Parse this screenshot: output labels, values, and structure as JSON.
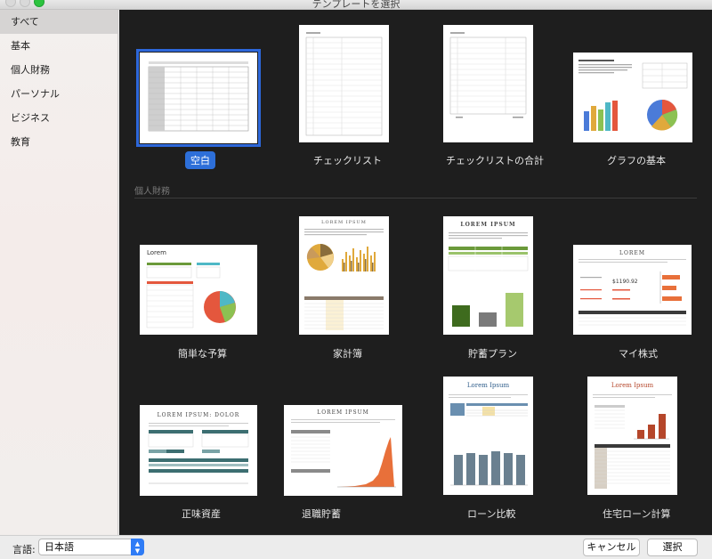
{
  "window": {
    "title": "テンプレートを選択"
  },
  "sidebar": {
    "items": [
      {
        "label": "すべて",
        "selected": true
      },
      {
        "label": "基本"
      },
      {
        "label": "個人財務"
      },
      {
        "label": "パーソナル"
      },
      {
        "label": "ビジネス"
      },
      {
        "label": "教育"
      }
    ]
  },
  "section": {
    "personal_finance": "個人財務"
  },
  "templates": {
    "blank": "空白",
    "checklist": "チェックリスト",
    "checklist_total": "チェックリストの合計",
    "chart_basics": "グラフの基本",
    "simple_budget": "簡単な予算",
    "household_budget": "家計簿",
    "savings_plan": "貯蓄プラン",
    "my_stocks": "マイ株式",
    "net_worth": "正味資産",
    "retirement": "退職貯蓄",
    "loan_compare": "ローン比較",
    "mortgage": "住宅ローン計算"
  },
  "thumb_text": {
    "lorem": "Lorem",
    "lorem_ipsum_caps": "LOREM IPSUM",
    "lorem_caps": "LOREM",
    "lorem_ipsum_dolor": "LOREM IPSUM: DOLOR",
    "lorem_ipsum": "Lorem Ipsum",
    "stock_price": "$1190.92"
  },
  "footer": {
    "language_label": "言語:",
    "language_value": "日本語",
    "cancel": "キャンセル",
    "choose": "選択"
  },
  "colors": {
    "selection": "#2d67d9",
    "accent_teal": "#3c6e71",
    "accent_orange": "#e8703a",
    "accent_green": "#6b9a3a"
  }
}
